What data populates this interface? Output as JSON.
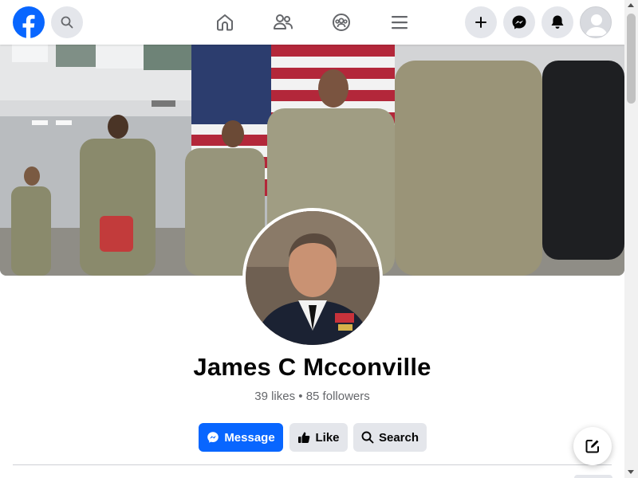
{
  "nav": {
    "logo_icon": "facebook-logo-icon",
    "search_icon": "search-icon",
    "tabs": [
      {
        "icon": "home-icon"
      },
      {
        "icon": "friends-icon"
      },
      {
        "icon": "groups-icon"
      },
      {
        "icon": "menu-icon"
      }
    ],
    "right_buttons": [
      {
        "icon": "plus-icon"
      },
      {
        "icon": "messenger-icon"
      },
      {
        "icon": "bell-icon"
      },
      {
        "icon": "account-avatar-icon"
      }
    ]
  },
  "profile": {
    "name": "James C Mcconville",
    "likes": "39 likes",
    "separator": "•",
    "followers": "85 followers"
  },
  "actions": {
    "message_label": "Message",
    "like_label": "Like",
    "search_label": "Search"
  },
  "colors": {
    "brand_blue": "#0866ff",
    "button_gray": "#e4e6eb",
    "secondary_text": "#65676b"
  }
}
